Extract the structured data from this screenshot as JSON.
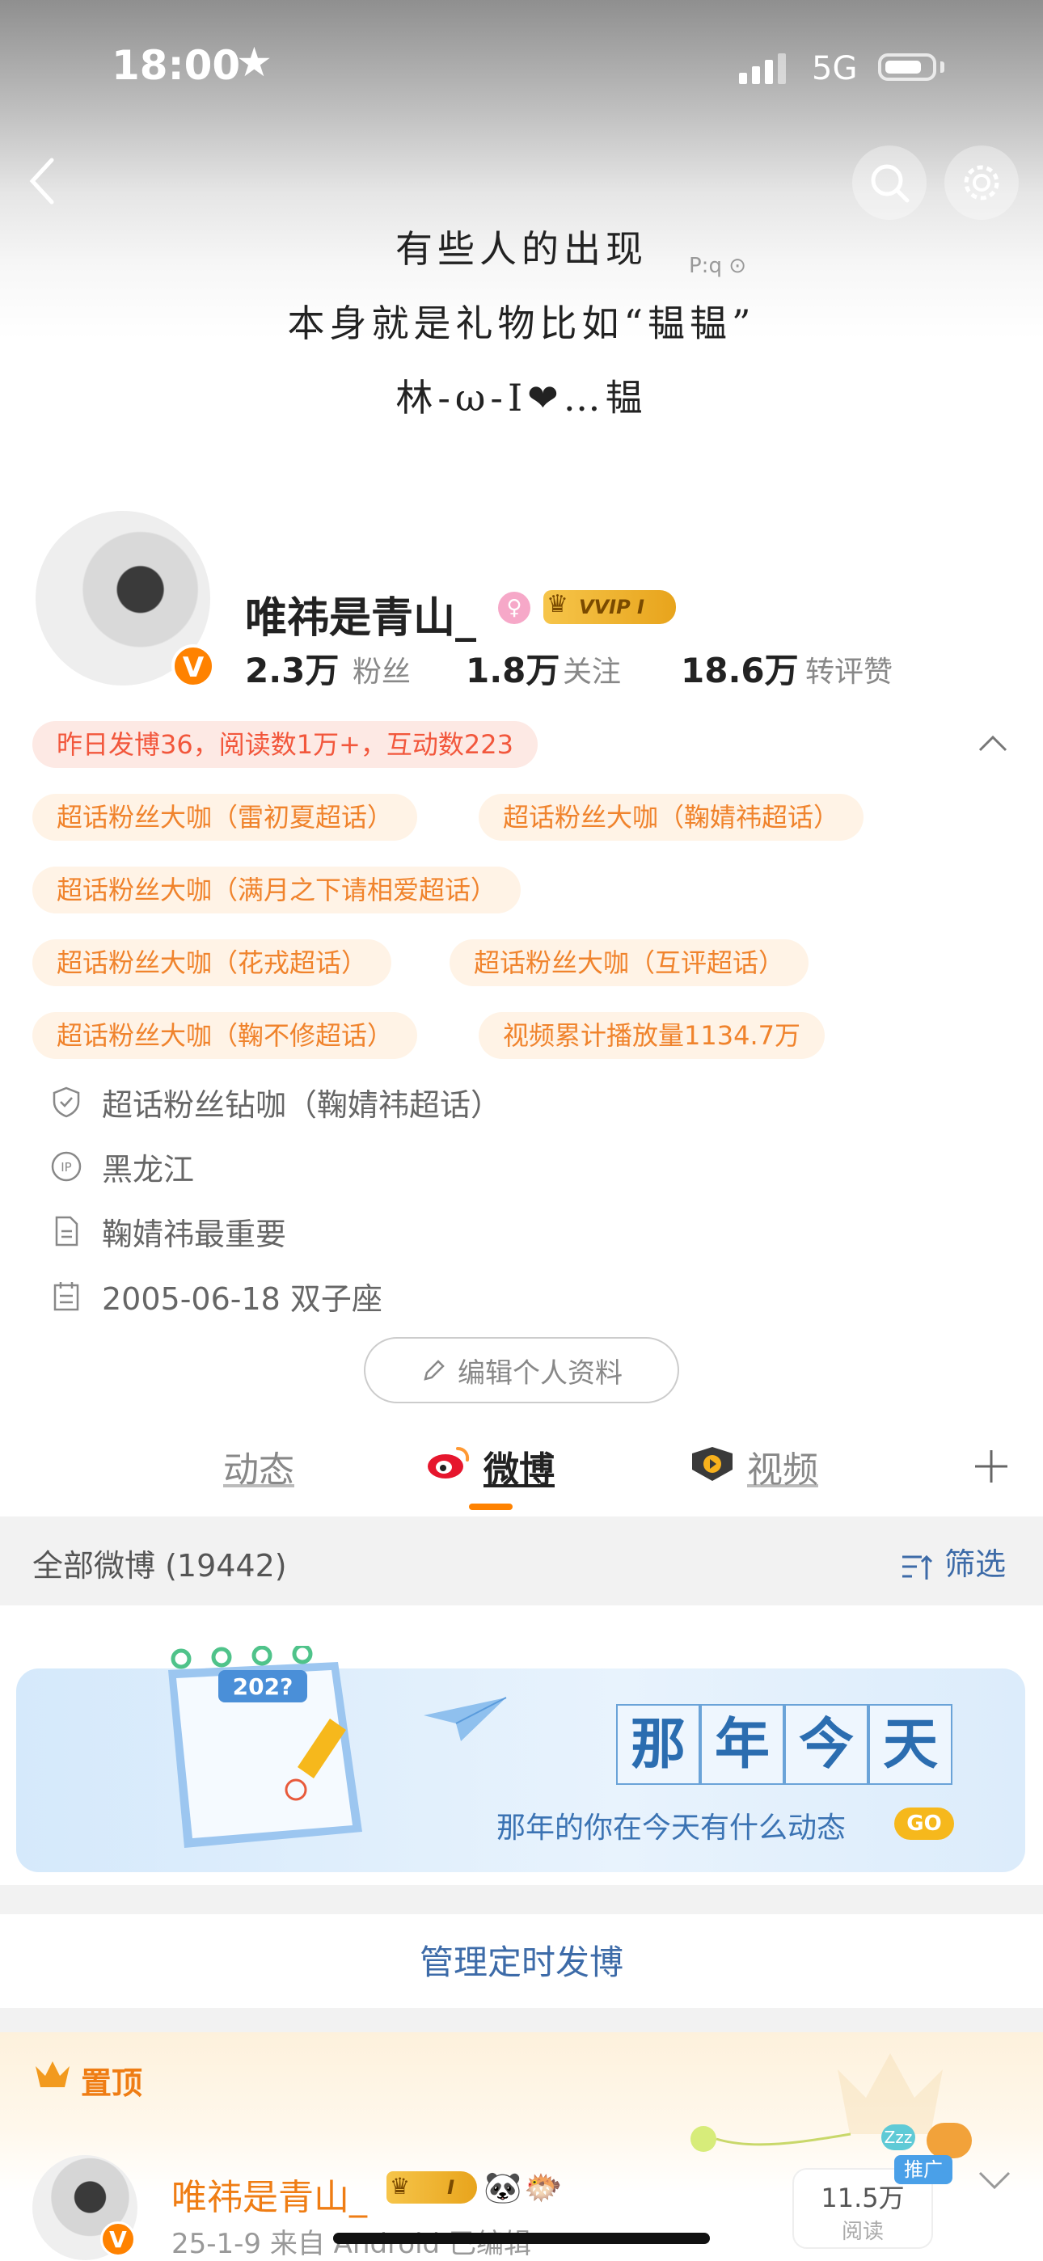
{
  "status_bar": {
    "time": "18:00",
    "network": "5G"
  },
  "cover": {
    "lines": [
      "有些人的出现",
      "本身就是礼物比如“韫韫”",
      "林-ω-I❤…韫"
    ],
    "tag": "P:q ⊙"
  },
  "profile": {
    "username": "唯祎是青山_",
    "vip_label": "VVIP I",
    "verified_badge": "V",
    "stats": [
      {
        "value": "2.3万",
        "label": "粉丝"
      },
      {
        "value": "1.8万",
        "label": "关注"
      },
      {
        "value": "18.6万",
        "label": "转评赞"
      }
    ]
  },
  "tags": {
    "summary": "昨日发博36，阅读数1万+，互动数223",
    "badges": [
      "超话粉丝大咖（雷初夏超话）",
      "超话粉丝大咖（鞠婧祎超话）",
      "超话粉丝大咖（满月之下请相爱超话）",
      "超话粉丝大咖（花戎超话）",
      "超话粉丝大咖（互评超话）",
      "超话粉丝大咖（鞠不修超话）",
      "视频累计播放量1134.7万"
    ]
  },
  "info": {
    "supertopic": "超话粉丝钻咖（鞠婧祎超话）",
    "ip": "黑龙江",
    "bio": "鞠婧祎最重要",
    "birthday": "2005-06-18 双子座",
    "ip_icon_text": "IP"
  },
  "edit_button": "编辑个人资料",
  "tabs": [
    {
      "label": "动态"
    },
    {
      "label": "微博"
    },
    {
      "label": "视频"
    }
  ],
  "list_header": {
    "all": "全部微博 (19442)",
    "filter": "筛选"
  },
  "banner": {
    "title_chars": [
      "那",
      "年",
      "今",
      "天"
    ],
    "subtitle": "那年的你在今天有什么动态",
    "go": "GO",
    "calendar_year": "202?"
  },
  "manage_scheduled": "管理定时发博",
  "pinned": {
    "label": "置顶",
    "author": "唯祎是青山_",
    "meta": "25-1-9  来自 Android  已编辑",
    "reads": "11.5万",
    "reads_label": "阅读",
    "promo": "推广",
    "level_badge": "I",
    "zzz": "Zzz"
  },
  "colors": {
    "accent": "#ff8200",
    "link_blue": "#3d6ba8",
    "tag_bg": "#fff3e6",
    "tag_text": "#f0832c"
  }
}
